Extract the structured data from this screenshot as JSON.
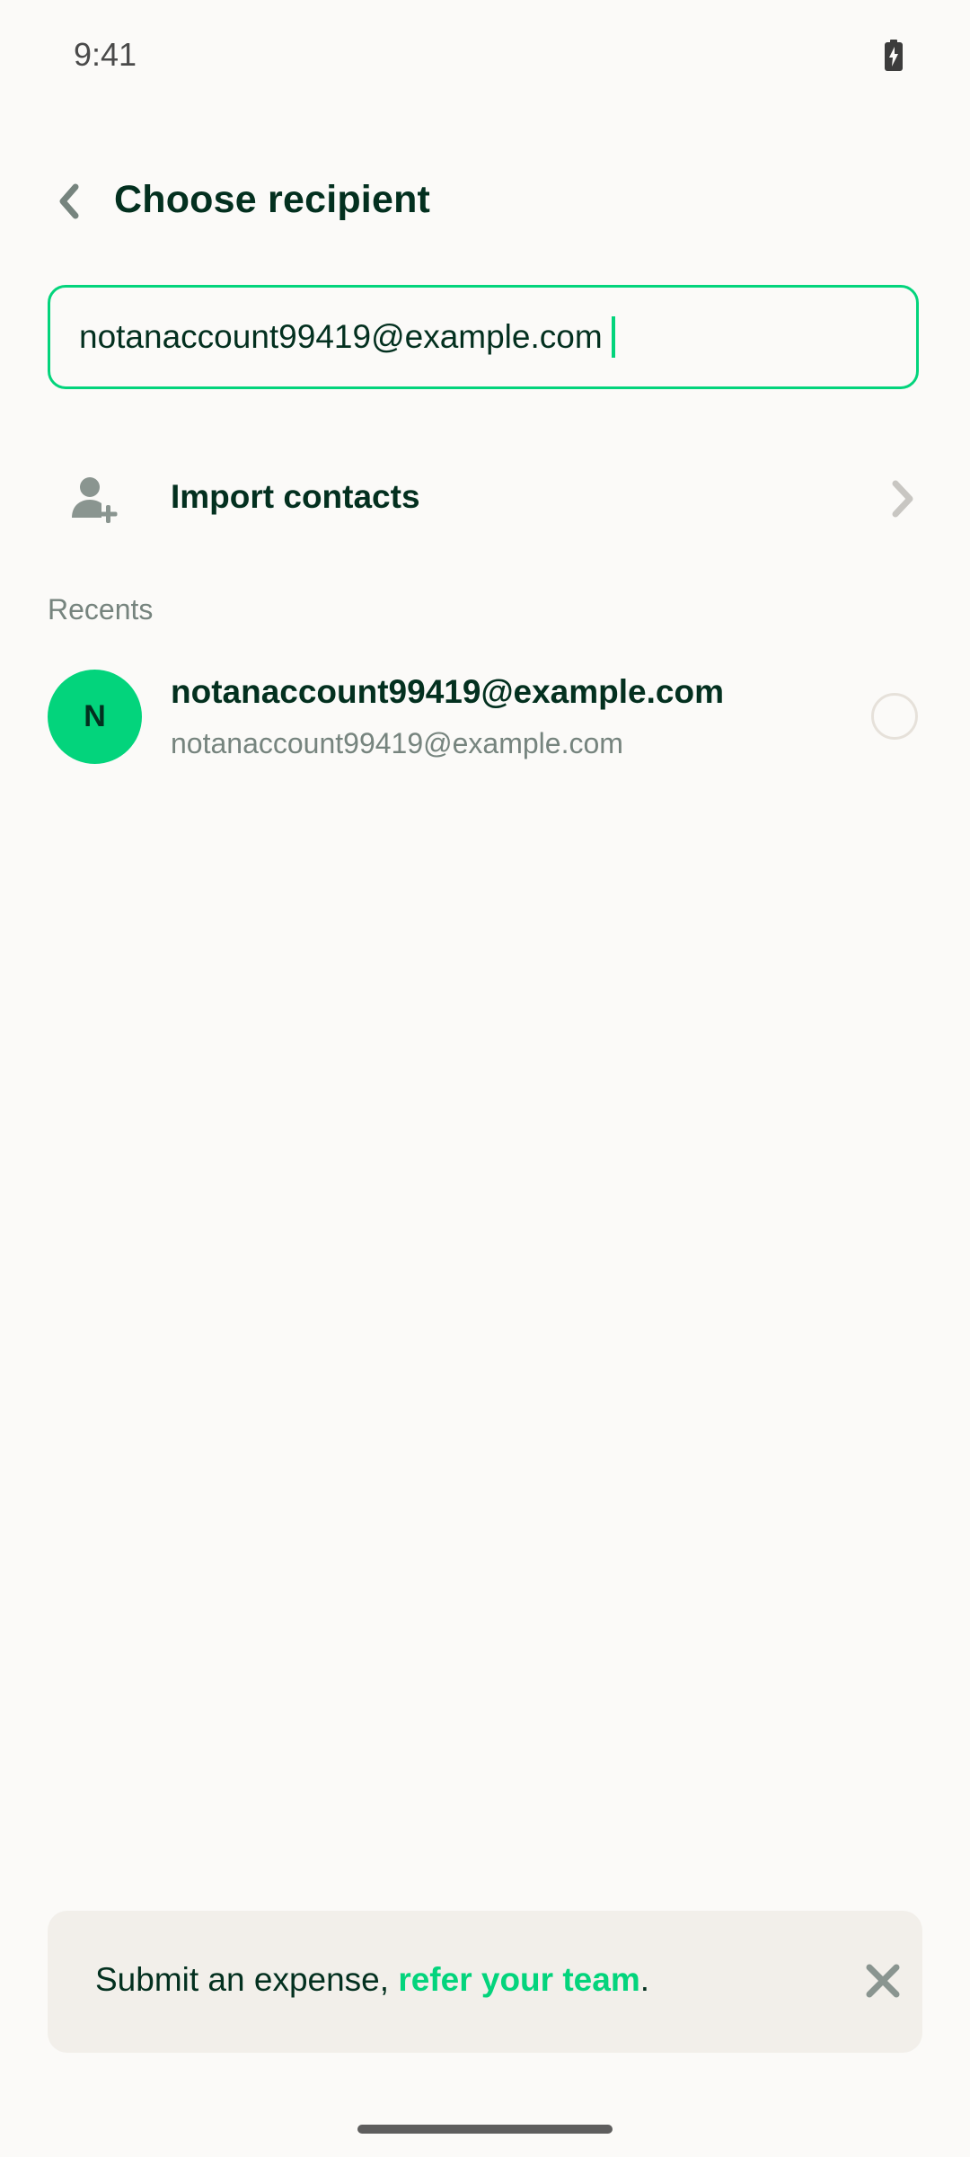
{
  "status_bar": {
    "time": "9:41",
    "battery_icon": "battery-charging-icon"
  },
  "header": {
    "title": "Choose recipient",
    "back_icon": "chevron-left-icon"
  },
  "search": {
    "value": "notanaccount99419@example.com"
  },
  "import_contacts": {
    "label": "Import contacts",
    "icon": "add-person-icon",
    "chevron": "chevron-right-icon"
  },
  "recents": {
    "section_label": "Recents",
    "items": [
      {
        "avatar_initial": "N",
        "name": "notanaccount99419@example.com",
        "subtitle": "notanaccount99419@example.com",
        "selected": false
      }
    ]
  },
  "banner": {
    "text_before": "Submit an expense, ",
    "link_text": "refer your team",
    "text_after": ".",
    "close_icon": "close-icon"
  },
  "colors": {
    "accent": "#03D47C",
    "text_primary": "#03301F",
    "text_secondary": "#76847E",
    "background": "#FBFAF8",
    "banner_bg": "#F2EFEA"
  }
}
